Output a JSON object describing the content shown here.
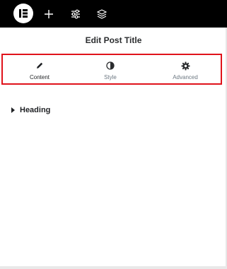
{
  "topbar": {
    "logo": "elementor-logo-icon",
    "icons": [
      "plus-icon",
      "sliders-icon",
      "layers-icon"
    ]
  },
  "panel": {
    "title": "Edit Post Title"
  },
  "tabs": [
    {
      "label": "Content",
      "icon": "pencil-icon",
      "active": true
    },
    {
      "label": "Style",
      "icon": "half-circle-icon",
      "active": false
    },
    {
      "label": "Advanced",
      "icon": "gear-icon",
      "active": false
    }
  ],
  "sections": [
    {
      "label": "Heading",
      "icon": "caret-right-icon"
    }
  ],
  "colors": {
    "topbar": "#000000",
    "highlight_border": "#e0121b",
    "text_dark": "#1f2124",
    "text_muted": "#6d7882"
  }
}
